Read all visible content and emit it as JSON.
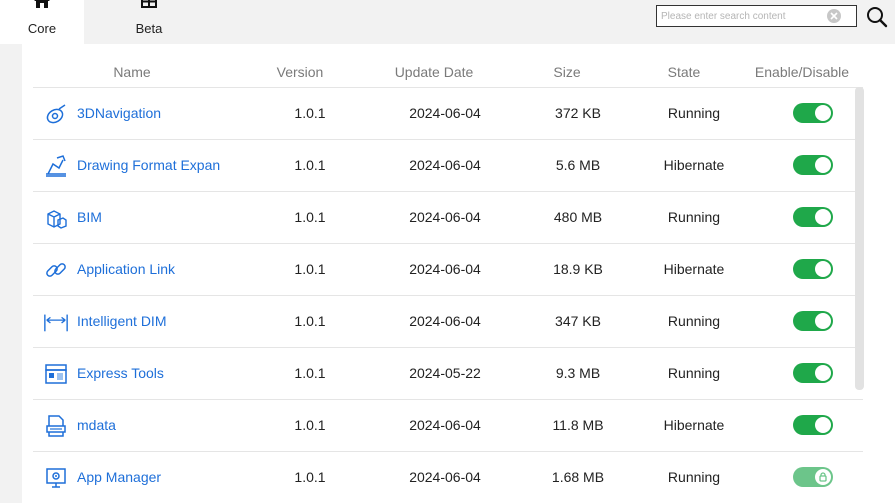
{
  "tabs": [
    {
      "label": "Core",
      "icon": "home-icon",
      "active": true
    },
    {
      "label": "Beta",
      "icon": "grid-icon",
      "active": false
    }
  ],
  "search": {
    "placeholder": "Please enter search content"
  },
  "columns": {
    "name": "Name",
    "version": "Version",
    "update_date": "Update Date",
    "size": "Size",
    "state": "State",
    "enable": "Enable/Disable"
  },
  "rows": [
    {
      "name": "3DNavigation",
      "icon": "3d-navigation-icon",
      "version": "1.0.1",
      "date": "2024-06-04",
      "size": "372 KB",
      "state": "Running",
      "enabled": true
    },
    {
      "name": "Drawing Format Expan",
      "icon": "drawing-format-icon",
      "version": "1.0.1",
      "date": "2024-06-04",
      "size": "5.6 MB",
      "state": "Hibernate",
      "enabled": true
    },
    {
      "name": "BIM",
      "icon": "bim-icon",
      "version": "1.0.1",
      "date": "2024-06-04",
      "size": "480 MB",
      "state": "Running",
      "enabled": true
    },
    {
      "name": "Application Link",
      "icon": "link-icon",
      "version": "1.0.1",
      "date": "2024-06-04",
      "size": "18.9 KB",
      "state": "Hibernate",
      "enabled": true
    },
    {
      "name": "Intelligent DIM",
      "icon": "dimension-icon",
      "version": "1.0.1",
      "date": "2024-06-04",
      "size": "347 KB",
      "state": "Running",
      "enabled": true
    },
    {
      "name": "Express Tools",
      "icon": "express-tools-icon",
      "version": "1.0.1",
      "date": "2024-05-22",
      "size": "9.3 MB",
      "state": "Running",
      "enabled": true
    },
    {
      "name": "mdata",
      "icon": "mdata-icon",
      "version": "1.0.1",
      "date": "2024-06-04",
      "size": "11.8 MB",
      "state": "Hibernate",
      "enabled": true
    },
    {
      "name": "App Manager",
      "icon": "app-manager-icon",
      "version": "1.0.1",
      "date": "2024-06-04",
      "size": "1.68 MB",
      "state": "Running",
      "enabled": true,
      "locked": true
    }
  ],
  "colors": {
    "accent": "#1e6fd9",
    "toggle_on": "#1fa84a",
    "toggle_locked": "#6cc58a"
  }
}
